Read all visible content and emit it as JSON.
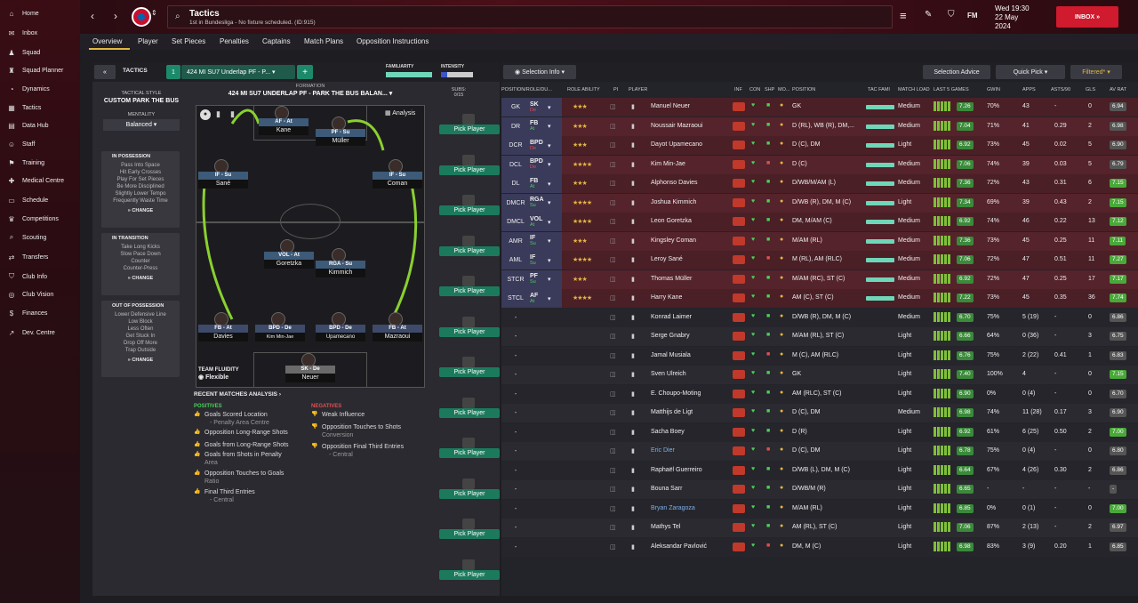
{
  "sidebar": {
    "items": [
      "Home",
      "Inbox",
      "Squad",
      "Squad Planner",
      "Dynamics",
      "Tactics",
      "Data Hub",
      "Staff",
      "Training",
      "Medical Centre",
      "Schedule",
      "Competitions",
      "Scouting",
      "Transfers",
      "Club Info",
      "Club Vision",
      "Finances",
      "Dev. Centre"
    ]
  },
  "header": {
    "title": "Tactics",
    "subtitle": "1st in Bundesliga - No fixture scheduled. (ID:915)",
    "date_line1": "Wed 19:30",
    "date_line2": "22 May",
    "date_line3": "2024",
    "inbox": "INBOX",
    "fm": "FM"
  },
  "tabs": [
    "Overview",
    "Player",
    "Set Pieces",
    "Penalties",
    "Captains",
    "Match Plans",
    "Opposition Instructions"
  ],
  "tactics": {
    "back": "«",
    "label": "TACTICS",
    "slot": "1",
    "name": "424 MI SU7 Underlap PF - P...",
    "add": "+",
    "familiarity": "FAMILIARITY",
    "intensity": "INTENSITY",
    "formation_label": "FORMATION",
    "formation_name": "424 MI SU7 UNDERLAP PF - PARK THE BUS BALAN...",
    "subs_label": "SUBS:",
    "subs_count": "0/15",
    "analysis": "Analysis",
    "style_label": "TACTICAL STYLE",
    "style": "CUSTOM PARK THE BUS",
    "mentality_label": "MENTALITY",
    "mentality": "Balanced",
    "in_possession": {
      "title": "IN POSSESSION",
      "lines": [
        "Pass Into Space",
        "Hit Early Crosses",
        "Play For Set Pieces",
        "Be More Disciplined",
        "Slightly Lower Tempo",
        "Frequently Waste Time"
      ],
      "change": "CHANGE"
    },
    "in_transition": {
      "title": "IN TRANSITION",
      "lines": [
        "Take Long Kicks",
        "Slow Pace Down",
        "Counter",
        "Counter-Press"
      ],
      "change": "CHANGE"
    },
    "out_of_possession": {
      "title": "OUT OF POSSESSION",
      "lines": [
        "Lower Defensive Line",
        "Low Block",
        "Less Often",
        "Get Stuck In",
        "Drop Off More",
        "Trap Outside"
      ],
      "change": "CHANGE"
    },
    "fluidity_label": "TEAM FLUIDITY",
    "fluidity": "Flexible",
    "pick_player": "Pick Player"
  },
  "pitch": [
    {
      "role": "AF - At",
      "name": "Kane"
    },
    {
      "role": "PF - Su",
      "name": "Müller"
    },
    {
      "role": "IF - Su",
      "name": "Sané"
    },
    {
      "role": "IF - Su",
      "name": "Coman"
    },
    {
      "role": "VOL - At",
      "name": "Goretzka"
    },
    {
      "role": "RGA - Su",
      "name": "Kimmich"
    },
    {
      "role": "FB - At",
      "name": "Davies"
    },
    {
      "role": "BPD - De",
      "name": "Kim Min-Jae"
    },
    {
      "role": "BPD - De",
      "name": "Upamecano"
    },
    {
      "role": "FB - At",
      "name": "Mazraoui"
    },
    {
      "role": "SK - De",
      "name": "Neuer"
    }
  ],
  "recent": {
    "title": "RECENT MATCHES ANALYSIS ›",
    "pos_label": "POSITIVES",
    "neg_label": "NEGATIVES",
    "positives": [
      "Goals Scored Location",
      "- Penalty Area Centre",
      "Opposition Long-Range Shots",
      "Goals from Long-Range Shots",
      "Goals from Shots in Penalty",
      "Area",
      "Opposition Touches to Goals",
      "Ratio",
      "Final Third Entries",
      "- Central"
    ],
    "negatives": [
      "Weak Influence",
      "Opposition Touches to Shots",
      "Conversion",
      "Opposition Final Third Entries",
      "- Central"
    ]
  },
  "table_toolbar": {
    "selection_info": "Selection Info",
    "selection_advice": "Selection Advice",
    "quick_pick": "Quick Pick",
    "filtered": "Filtered*"
  },
  "table_headers": [
    "POSITION/ROLE/DU...",
    "ROLE ABILITY",
    "PI",
    "PLAYER",
    "INF",
    "CON",
    "SHP",
    "MO...",
    "POSITION",
    "TAC FAMI",
    "MATCH LOAD",
    "LAST 5 GAMES",
    "GWIN",
    "APPS",
    "ASTS/90",
    "GLS",
    "AV RAT"
  ],
  "rows": [
    {
      "p1": "GK",
      "p2": "SK",
      "p3": "De",
      "stars": "★★★",
      "name": "Manuel Neuer",
      "pos": "GK",
      "load": "Medium",
      "l5": "7.26",
      "gwin": "70%",
      "apps": "43",
      "asts": "-",
      "gls": "0",
      "rat": "6.94"
    },
    {
      "p1": "DR",
      "p2": "FB",
      "p3": "At",
      "stars": "★★★",
      "name": "Noussair Mazraoui",
      "pos": "D (RL), WB (R), DM,...",
      "load": "Medium",
      "l5": "7.04",
      "gwin": "71%",
      "apps": "41",
      "asts": "0.29",
      "gls": "2",
      "rat": "6.98"
    },
    {
      "p1": "DCR",
      "p2": "BPD",
      "p3": "De",
      "stars": "★★★",
      "name": "Dayot Upamecano",
      "pos": "D (C), DM",
      "load": "Light",
      "l5": "6.92",
      "gwin": "73%",
      "apps": "45",
      "asts": "0.02",
      "gls": "5",
      "rat": "6.90"
    },
    {
      "p1": "DCL",
      "p2": "BPD",
      "p3": "De",
      "stars": "★★★★",
      "name": "Kim Min-Jae",
      "pos": "D (C)",
      "load": "Medium",
      "l5": "7.06",
      "gwin": "74%",
      "apps": "39",
      "asts": "0.03",
      "gls": "5",
      "rat": "6.79"
    },
    {
      "p1": "DL",
      "p2": "FB",
      "p3": "At",
      "stars": "★★★",
      "name": "Alphonso Davies",
      "pos": "D/WB/M/AM (L)",
      "load": "Medium",
      "l5": "7.36",
      "gwin": "72%",
      "apps": "43",
      "asts": "0.31",
      "gls": "6",
      "rat": "7.15"
    },
    {
      "p1": "DMCR",
      "p2": "RGA",
      "p3": "Su",
      "stars": "★★★★",
      "name": "Joshua Kimmich",
      "pos": "D/WB (R), DM, M (C)",
      "load": "Light",
      "l5": "7.34",
      "gwin": "69%",
      "apps": "39",
      "asts": "0.43",
      "gls": "2",
      "rat": "7.15"
    },
    {
      "p1": "DMCL",
      "p2": "VOL",
      "p3": "At",
      "stars": "★★★★",
      "name": "Leon Goretzka",
      "pos": "DM, M/AM (C)",
      "load": "Medium",
      "l5": "6.92",
      "gwin": "74%",
      "apps": "46",
      "asts": "0.22",
      "gls": "13",
      "rat": "7.12"
    },
    {
      "p1": "AMR",
      "p2": "IF",
      "p3": "Su",
      "stars": "★★★",
      "name": "Kingsley Coman",
      "pos": "M/AM (RL)",
      "load": "Medium",
      "l5": "7.36",
      "gwin": "73%",
      "apps": "45",
      "asts": "0.25",
      "gls": "11",
      "rat": "7.11"
    },
    {
      "p1": "AML",
      "p2": "IF",
      "p3": "Su",
      "stars": "★★★★",
      "name": "Leroy Sané",
      "pos": "M (RL), AM (RLC)",
      "load": "Medium",
      "l5": "7.06",
      "gwin": "72%",
      "apps": "47",
      "asts": "0.51",
      "gls": "11",
      "rat": "7.27"
    },
    {
      "p1": "STCR",
      "p2": "PF",
      "p3": "Su",
      "stars": "★★★",
      "name": "Thomas Müller",
      "pos": "M/AM (RC), ST (C)",
      "load": "Medium",
      "l5": "6.92",
      "gwin": "72%",
      "apps": "47",
      "asts": "0.25",
      "gls": "17",
      "rat": "7.17"
    },
    {
      "p1": "STCL",
      "p2": "AF",
      "p3": "At",
      "stars": "★★★★",
      "name": "Harry Kane",
      "pos": "AM (C), ST (C)",
      "load": "Medium",
      "l5": "7.22",
      "gwin": "73%",
      "apps": "45",
      "asts": "0.35",
      "gls": "36",
      "rat": "7.74"
    },
    {
      "p1": "-",
      "p2": "",
      "p3": "",
      "stars": "",
      "name": "Konrad Laimer",
      "pos": "D/WB (R), DM, M (C)",
      "load": "Medium",
      "l5": "6.70",
      "gwin": "75%",
      "apps": "5 (19)",
      "asts": "-",
      "gls": "0",
      "rat": "6.86"
    },
    {
      "p1": "-",
      "p2": "",
      "p3": "",
      "stars": "",
      "name": "Serge Gnabry",
      "pos": "M/AM (RL), ST (C)",
      "load": "Light",
      "l5": "6.66",
      "gwin": "64%",
      "apps": "0 (36)",
      "asts": "-",
      "gls": "3",
      "rat": "6.75"
    },
    {
      "p1": "-",
      "p2": "",
      "p3": "",
      "stars": "",
      "name": "Jamal Musiala",
      "pos": "M (C), AM (RLC)",
      "load": "Light",
      "l5": "6.76",
      "gwin": "75%",
      "apps": "2 (22)",
      "asts": "0.41",
      "gls": "1",
      "rat": "6.83"
    },
    {
      "p1": "-",
      "p2": "",
      "p3": "",
      "stars": "",
      "name": "Sven Ulreich",
      "pos": "GK",
      "load": "Light",
      "l5": "7.40",
      "gwin": "100%",
      "apps": "4",
      "asts": "-",
      "gls": "0",
      "rat": "7.15"
    },
    {
      "p1": "-",
      "p2": "",
      "p3": "",
      "stars": "",
      "name": "E. Choupo-Moting",
      "pos": "AM (RLC), ST (C)",
      "load": "Light",
      "l5": "6.90",
      "gwin": "0%",
      "apps": "0 (4)",
      "asts": "-",
      "gls": "0",
      "rat": "6.70"
    },
    {
      "p1": "-",
      "p2": "",
      "p3": "",
      "stars": "",
      "name": "Matthijs de Ligt",
      "pos": "D (C), DM",
      "load": "Medium",
      "l5": "6.98",
      "gwin": "74%",
      "apps": "11 (28)",
      "asts": "0.17",
      "gls": "3",
      "rat": "6.90"
    },
    {
      "p1": "-",
      "p2": "",
      "p3": "",
      "stars": "",
      "name": "Sacha Boey",
      "pos": "D (R)",
      "load": "Light",
      "l5": "6.92",
      "gwin": "61%",
      "apps": "6 (25)",
      "asts": "0.50",
      "gls": "2",
      "rat": "7.00"
    },
    {
      "p1": "-",
      "p2": "",
      "p3": "",
      "stars": "",
      "name": "Eric Dier",
      "pos": "D (C), DM",
      "load": "Light",
      "l5": "6.78",
      "gwin": "75%",
      "apps": "0 (4)",
      "asts": "-",
      "gls": "0",
      "rat": "6.80"
    },
    {
      "p1": "-",
      "p2": "",
      "p3": "",
      "stars": "",
      "name": "Raphaël Guerreiro",
      "pos": "D/WB (L), DM, M (C)",
      "load": "Light",
      "l5": "6.64",
      "gwin": "67%",
      "apps": "4 (26)",
      "asts": "0.30",
      "gls": "2",
      "rat": "6.86"
    },
    {
      "p1": "-",
      "p2": "",
      "p3": "",
      "stars": "",
      "name": "Bouna Sarr",
      "pos": "D/WB/M (R)",
      "load": "Light",
      "l5": "6.65",
      "gwin": "-",
      "apps": "-",
      "asts": "-",
      "gls": "-",
      "rat": "-"
    },
    {
      "p1": "-",
      "p2": "",
      "p3": "",
      "stars": "",
      "name": "Bryan Zaragoza",
      "pos": "M/AM (RL)",
      "load": "Light",
      "l5": "6.85",
      "gwin": "0%",
      "apps": "0 (1)",
      "asts": "-",
      "gls": "0",
      "rat": "7.00"
    },
    {
      "p1": "-",
      "p2": "",
      "p3": "",
      "stars": "",
      "name": "Mathys Tel",
      "pos": "AM (RL), ST (C)",
      "load": "Light",
      "l5": "7.06",
      "gwin": "87%",
      "apps": "2 (13)",
      "asts": "-",
      "gls": "2",
      "rat": "6.97"
    },
    {
      "p1": "-",
      "p2": "",
      "p3": "",
      "stars": "",
      "name": "Aleksandar Pavlović",
      "pos": "DM, M (C)",
      "load": "Light",
      "l5": "6.98",
      "gwin": "83%",
      "apps": "3 (9)",
      "asts": "0.20",
      "gls": "1",
      "rat": "6.85"
    }
  ]
}
